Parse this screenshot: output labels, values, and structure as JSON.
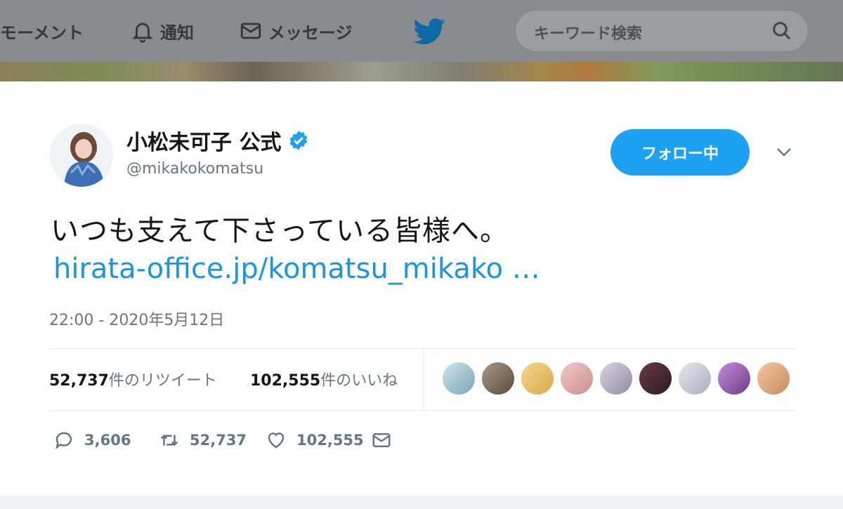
{
  "nav": {
    "moments": "モーメント",
    "notifications": "通知",
    "messages": "メッセージ",
    "search_placeholder": "キーワード検索"
  },
  "tweet": {
    "author_name": "小松未可子 公式",
    "handle": "@mikakokomatsu",
    "follow_label": "フォロー中",
    "text": "いつも支えて下さっている皆様へ。",
    "link": "hirata-office.jp/komatsu_mikako …",
    "timestamp": "22:00 - 2020年5月12日",
    "retweet_count_bold": "52,737",
    "retweet_suffix": "件のリツイート",
    "like_count_bold": "102,555",
    "like_suffix": "件のいいね",
    "reply_count": "3,606",
    "retweet_count": "52,737",
    "like_count": "102,555"
  },
  "colors": {
    "accent": "#1da1f2",
    "link": "#1b95e0",
    "muted": "#657786"
  },
  "icons": [
    "bell-icon",
    "envelope-icon",
    "twitter-bird-icon",
    "search-icon",
    "verified-badge-icon",
    "chevron-down-icon",
    "reply-icon",
    "retweet-icon",
    "heart-icon",
    "direct-message-icon"
  ]
}
